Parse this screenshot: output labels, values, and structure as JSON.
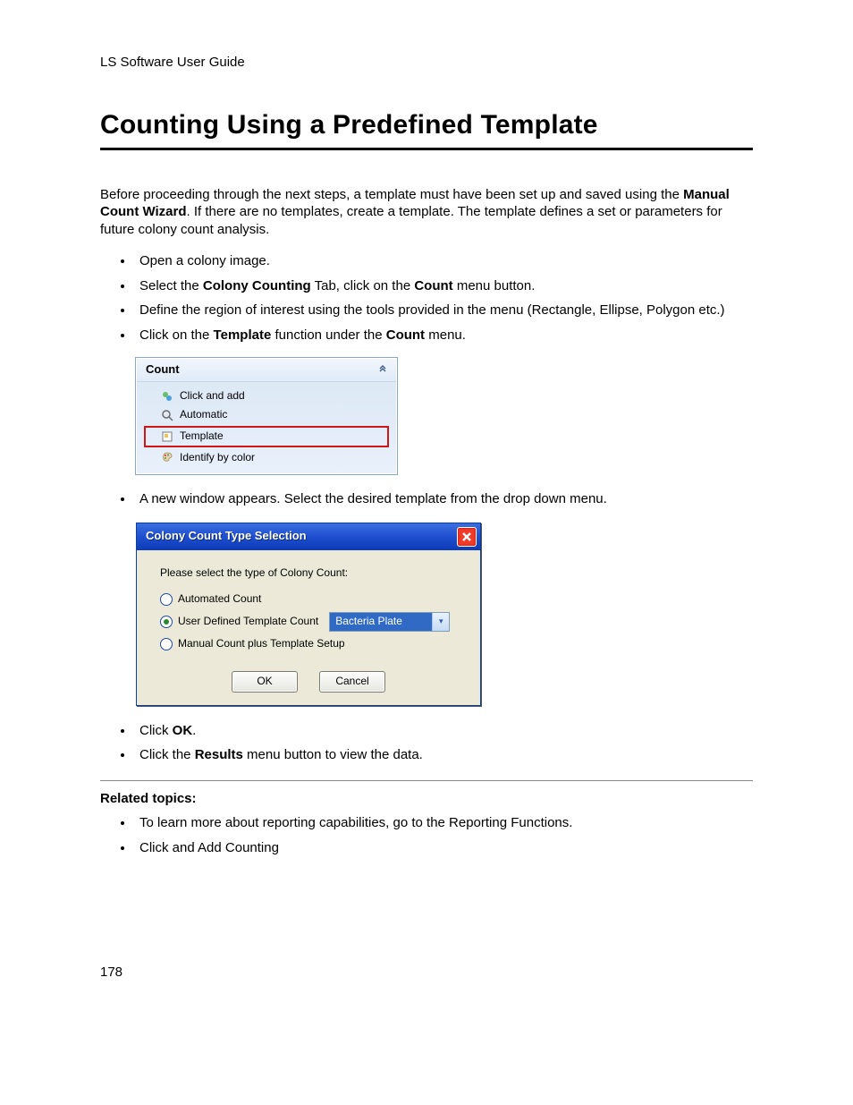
{
  "header": "LS Software User Guide",
  "title": "Counting Using a Predefined Template",
  "intro": {
    "pre": "Before proceeding through the next steps, a template must have been set up and saved using the ",
    "bold": "Manual Count Wizard",
    "post": ". If there are no templates, create a template. The template defines a set or parameters for future colony count analysis."
  },
  "bullets1": {
    "b1": "Open a colony image.",
    "b2_a": "Select the ",
    "b2_b": "Colony Counting",
    "b2_c": " Tab, click on the ",
    "b2_d": "Count",
    "b2_e": " menu button.",
    "b3": "Define the region of interest using the tools provided in the menu (Rectangle, Ellipse, Polygon etc.)",
    "b4_a": "Click on the ",
    "b4_b": "Template",
    "b4_c": " function under the ",
    "b4_d": "Count",
    "b4_e": " menu."
  },
  "count_panel": {
    "title": "Count",
    "items": {
      "click_add": "Click and add",
      "automatic": "Automatic",
      "template": "Template",
      "identify": "Identify by color"
    }
  },
  "bullets2": {
    "b5": "A new window appears.  Select the desired template from the drop down menu."
  },
  "dialog": {
    "title": "Colony Count Type Selection",
    "prompt": "Please select the type of Colony Count:",
    "opt1": "Automated Count",
    "opt2": "User Defined Template Count",
    "combo": "Bacteria Plate",
    "opt3": "Manual Count plus Template Setup",
    "ok": "OK",
    "cancel": "Cancel"
  },
  "bullets3": {
    "b6_a": "Click ",
    "b6_b": "OK",
    "b6_c": ".",
    "b7_a": "Click the ",
    "b7_b": "Results",
    "b7_c": " menu button to view the data."
  },
  "related": {
    "heading": "Related topics:",
    "r1": "To learn more about reporting capabilities, go to the Reporting Functions.",
    "r2": "Click and Add Counting"
  },
  "page_number": "178"
}
